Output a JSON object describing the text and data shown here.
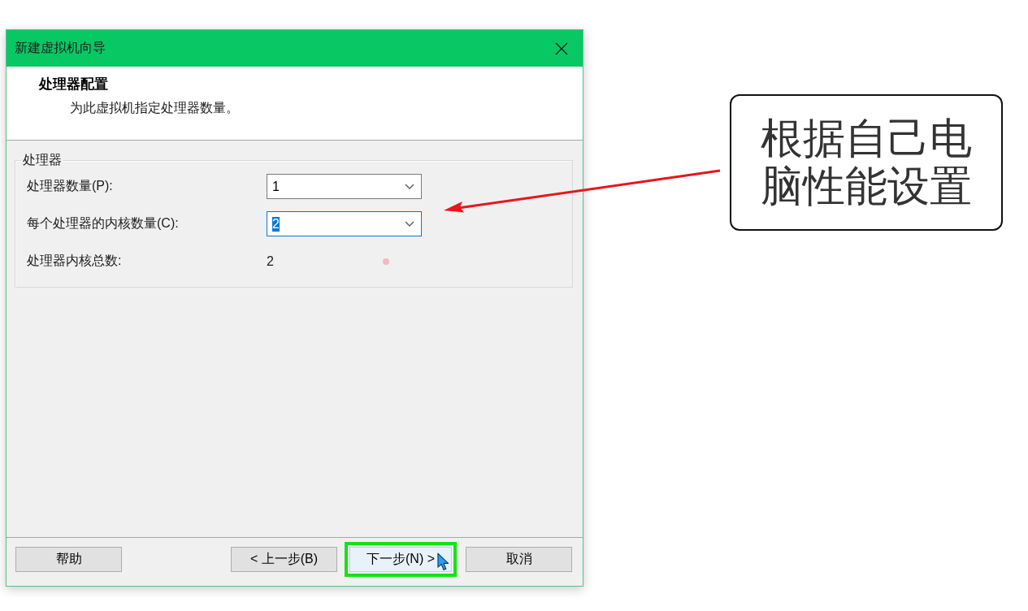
{
  "window": {
    "title": "新建虚拟机向导"
  },
  "header": {
    "title": "处理器配置",
    "subtitle": "为此虚拟机指定处理器数量。"
  },
  "group": {
    "legend": "处理器",
    "fields": [
      {
        "kind": "dropdown",
        "label": "处理器数量(P):",
        "value": "1",
        "focused": false
      },
      {
        "kind": "dropdown",
        "label": "每个处理器的内核数量(C):",
        "value": "2",
        "focused": true
      },
      {
        "kind": "readout",
        "label": "处理器内核总数:",
        "value": "2"
      }
    ]
  },
  "buttons": [
    {
      "label": "帮助",
      "highlighted": false,
      "hovered": false
    },
    {
      "label": "< 上一步(B)",
      "highlighted": false,
      "hovered": false
    },
    {
      "label": "下一步(N) >",
      "highlighted": true,
      "hovered": true
    },
    {
      "label": "取消",
      "highlighted": false,
      "hovered": false
    }
  ],
  "callout": {
    "text": "根据自己电脑性能设置"
  }
}
